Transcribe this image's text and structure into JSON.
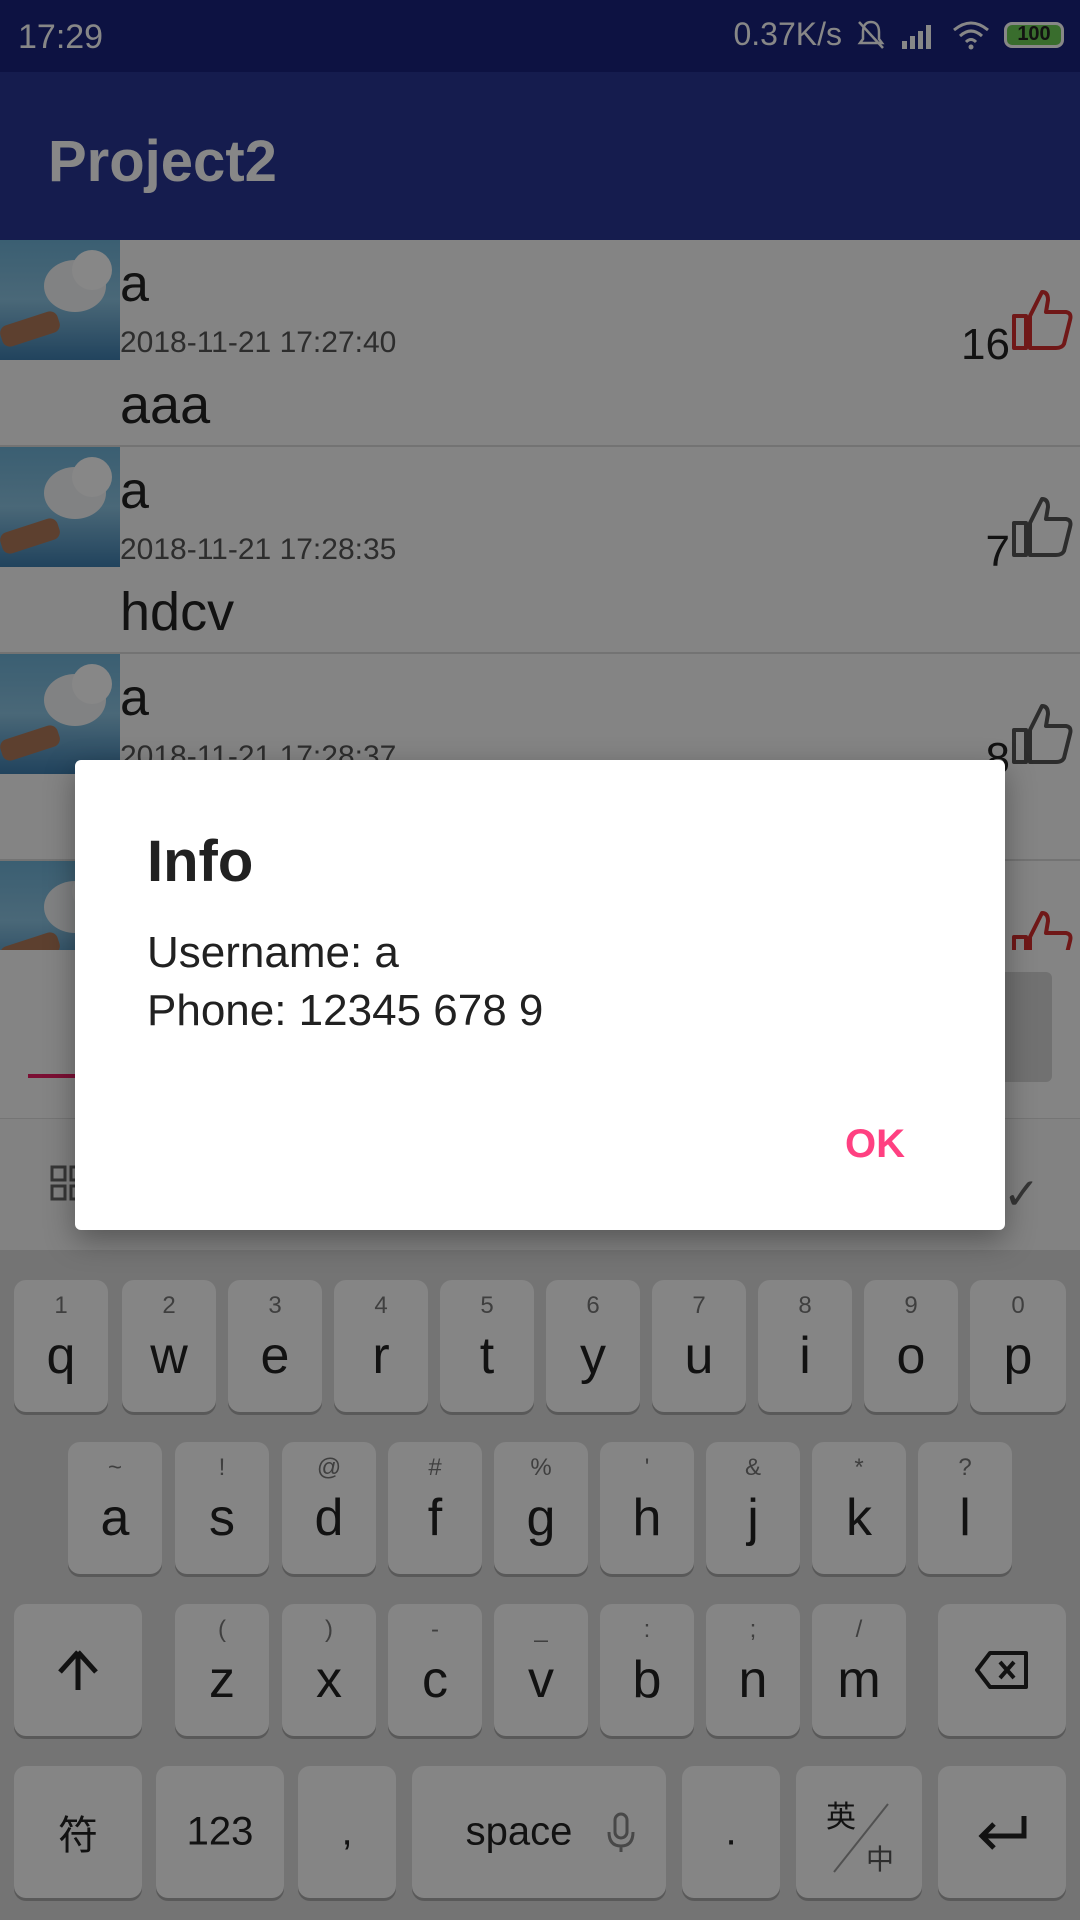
{
  "status_bar": {
    "time": "17:29",
    "net_speed": "0.37K/s",
    "battery": "100"
  },
  "app_bar": {
    "title": "Project2"
  },
  "posts": [
    {
      "user": "a",
      "time": "2018-11-21 17:27:40",
      "body": "aaa",
      "likes": "16",
      "liked": true
    },
    {
      "user": "a",
      "time": "2018-11-21 17:28:35",
      "body": "hdcv",
      "likes": "7",
      "liked": false
    },
    {
      "user": "a",
      "time": "2018-11-21 17:28:37",
      "body": "",
      "likes": "8",
      "liked": false
    },
    {
      "user": "",
      "time": "",
      "body": "",
      "likes": "",
      "liked": true
    }
  ],
  "dialog": {
    "title": "Info",
    "username_line": "Username: a",
    "phone_line": "Phone: 12345 678 9",
    "ok_label": "OK"
  },
  "keyboard": {
    "row1": [
      {
        "main": "q",
        "sub": "1"
      },
      {
        "main": "w",
        "sub": "2"
      },
      {
        "main": "e",
        "sub": "3"
      },
      {
        "main": "r",
        "sub": "4"
      },
      {
        "main": "t",
        "sub": "5"
      },
      {
        "main": "y",
        "sub": "6"
      },
      {
        "main": "u",
        "sub": "7"
      },
      {
        "main": "i",
        "sub": "8"
      },
      {
        "main": "o",
        "sub": "9"
      },
      {
        "main": "p",
        "sub": "0"
      }
    ],
    "row2": [
      {
        "main": "a",
        "sub": "~"
      },
      {
        "main": "s",
        "sub": "!"
      },
      {
        "main": "d",
        "sub": "@"
      },
      {
        "main": "f",
        "sub": "#"
      },
      {
        "main": "g",
        "sub": "%"
      },
      {
        "main": "h",
        "sub": "'"
      },
      {
        "main": "j",
        "sub": "&"
      },
      {
        "main": "k",
        "sub": "*"
      },
      {
        "main": "l",
        "sub": "?"
      }
    ],
    "row3": [
      {
        "main": "z",
        "sub": "("
      },
      {
        "main": "x",
        "sub": ")"
      },
      {
        "main": "c",
        "sub": "-"
      },
      {
        "main": "v",
        "sub": "_"
      },
      {
        "main": "b",
        "sub": ":"
      },
      {
        "main": "n",
        "sub": ";"
      },
      {
        "main": "m",
        "sub": "/"
      }
    ],
    "symbols_label": "符",
    "numbers_label": "123",
    "comma_label": ",",
    "space_label": "space",
    "period_label": ".",
    "lang_top": "英",
    "lang_bottom": "中"
  }
}
